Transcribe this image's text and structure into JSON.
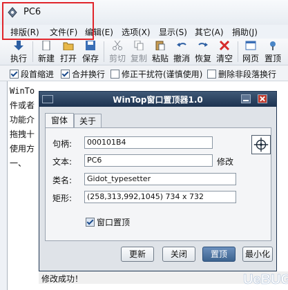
{
  "app": {
    "title": "PC6",
    "menu": [
      "排版(R)",
      "文件(F)",
      "编辑(E)",
      "选项(X)",
      "显示(S)",
      "其它(A)",
      "捐助(J)"
    ],
    "toolbar": [
      "执行",
      "新建",
      "打开",
      "保存",
      "剪切",
      "复制",
      "粘贴",
      "撤消",
      "恢复",
      "清空",
      "网页",
      "置顶"
    ],
    "options": [
      {
        "label": "段首缩进",
        "checked": true
      },
      {
        "label": "合并换行",
        "checked": true
      },
      {
        "label": "修正干扰符(谨慎使用)",
        "checked": false
      },
      {
        "label": "删除非段落换行",
        "checked": false
      }
    ],
    "editor_lines": [
      "WinTo",
      "件或者",
      "功能介",
      "拖拽十",
      "使用方",
      "一、"
    ],
    "status": "修改成功！"
  },
  "dialog": {
    "title": "WinTop窗口置顶器1.0",
    "tabs": [
      "窗体",
      "关于"
    ],
    "fields": {
      "handle_label": "句柄:",
      "handle_value": "000101B4",
      "text_label": "文本:",
      "text_value": "PC6",
      "modify_label": "修改",
      "class_label": "类名:",
      "class_value": "Gidot_typesetter",
      "rect_label": "矩形:",
      "rect_value": "(258,313,992,1045) 734 x 732"
    },
    "topmost_checkbox": {
      "label": "窗口置顶",
      "checked": true
    },
    "buttons": [
      "更新",
      "关闭",
      "置顶",
      "最小化"
    ]
  },
  "watermark": "UeBUG"
}
